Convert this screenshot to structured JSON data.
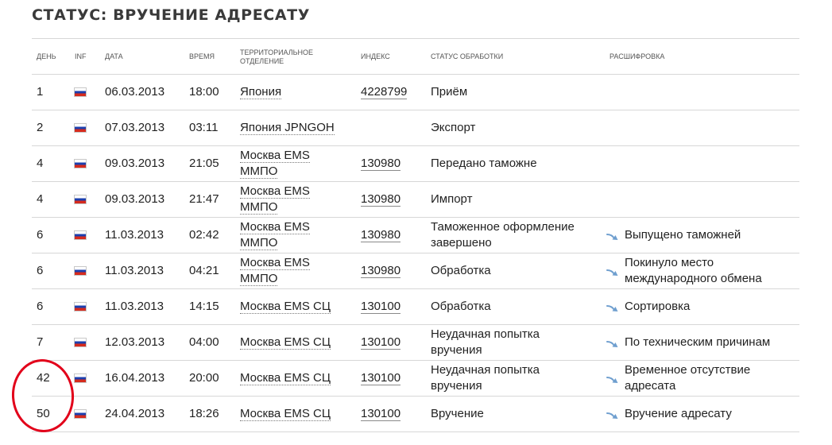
{
  "page": {
    "title": "СТАТУС: ВРУЧЕНИЕ АДРЕСАТУ"
  },
  "table": {
    "headers": {
      "day": "ДЕНЬ",
      "inf": "INF",
      "date": "ДАТА",
      "time": "ВРЕМЯ",
      "office_line1": "ТЕРРИТОРИАЛЬНОЕ",
      "office_line2": "ОТДЕЛЕНИЕ",
      "index": "ИНДЕКС",
      "status": "СТАТУС ОБРАБОТКИ",
      "decode": "РАСШИФРОВКА"
    },
    "rows": [
      {
        "day": "1",
        "flag": "russia-flag-icon",
        "date": "06.03.2013",
        "time": "18:00",
        "office_line1": "Япония",
        "office_line2": "",
        "index": "4228799",
        "status_line1": "Приём",
        "status_line2": "",
        "decode_line1": "",
        "decode_line2": ""
      },
      {
        "day": "2",
        "flag": "russia-flag-icon",
        "date": "07.03.2013",
        "time": "03:11",
        "office_line1": "Япония JPNGOH",
        "office_line2": "",
        "index": "",
        "status_line1": "Экспорт",
        "status_line2": "",
        "decode_line1": "",
        "decode_line2": ""
      },
      {
        "day": "4",
        "flag": "russia-flag-icon",
        "date": "09.03.2013",
        "time": "21:05",
        "office_line1": "Москва EMS",
        "office_line2": "ММПО",
        "index": "130980",
        "status_line1": "Передано таможне",
        "status_line2": "",
        "decode_line1": "",
        "decode_line2": ""
      },
      {
        "day": "4",
        "flag": "russia-flag-icon",
        "date": "09.03.2013",
        "time": "21:47",
        "office_line1": "Москва EMS",
        "office_line2": "ММПО",
        "index": "130980",
        "status_line1": "Импорт",
        "status_line2": "",
        "decode_line1": "",
        "decode_line2": ""
      },
      {
        "day": "6",
        "flag": "russia-flag-icon",
        "date": "11.03.2013",
        "time": "02:42",
        "office_line1": "Москва EMS",
        "office_line2": "ММПО",
        "index": "130980",
        "status_line1": "Таможенное оформление",
        "status_line2": "завершено",
        "decode_line1": "Выпущено таможней",
        "decode_line2": ""
      },
      {
        "day": "6",
        "flag": "russia-flag-icon",
        "date": "11.03.2013",
        "time": "04:21",
        "office_line1": "Москва EMS",
        "office_line2": "ММПО",
        "index": "130980",
        "status_line1": "Обработка",
        "status_line2": "",
        "decode_line1": "Покинуло место",
        "decode_line2": "международного обмена"
      },
      {
        "day": "6",
        "flag": "russia-flag-icon",
        "date": "11.03.2013",
        "time": "14:15",
        "office_line1": "Москва EMS СЦ",
        "office_line2": "",
        "index": "130100",
        "status_line1": "Обработка",
        "status_line2": "",
        "decode_line1": "Сортировка",
        "decode_line2": ""
      },
      {
        "day": "7",
        "flag": "russia-flag-icon",
        "date": "12.03.2013",
        "time": "04:00",
        "office_line1": "Москва EMS СЦ",
        "office_line2": "",
        "index": "130100",
        "status_line1": "Неудачная попытка",
        "status_line2": "вручения",
        "decode_line1": "По техническим причинам",
        "decode_line2": ""
      },
      {
        "day": "42",
        "flag": "russia-flag-icon",
        "date": "16.04.2013",
        "time": "20:00",
        "office_line1": "Москва EMS СЦ",
        "office_line2": "",
        "index": "130100",
        "status_line1": "Неудачная попытка",
        "status_line2": "вручения",
        "decode_line1": "Временное отсутствие",
        "decode_line2": "адресата"
      },
      {
        "day": "50",
        "flag": "russia-flag-icon",
        "date": "24.04.2013",
        "time": "18:26",
        "office_line1": "Москва EMS СЦ",
        "office_line2": "",
        "index": "130100",
        "status_line1": "Вручение",
        "status_line2": "",
        "decode_line1": "Вручение адресату",
        "decode_line2": ""
      }
    ]
  },
  "colors": {
    "text": "#222222",
    "header_text": "#555555",
    "row_border": "#d7d7d7",
    "arrow": "#6f9fcf",
    "annotation": "#e2001a"
  },
  "icons": {
    "flag": "russia-flag-icon",
    "decode_arrow": "curved-arrow-icon"
  }
}
